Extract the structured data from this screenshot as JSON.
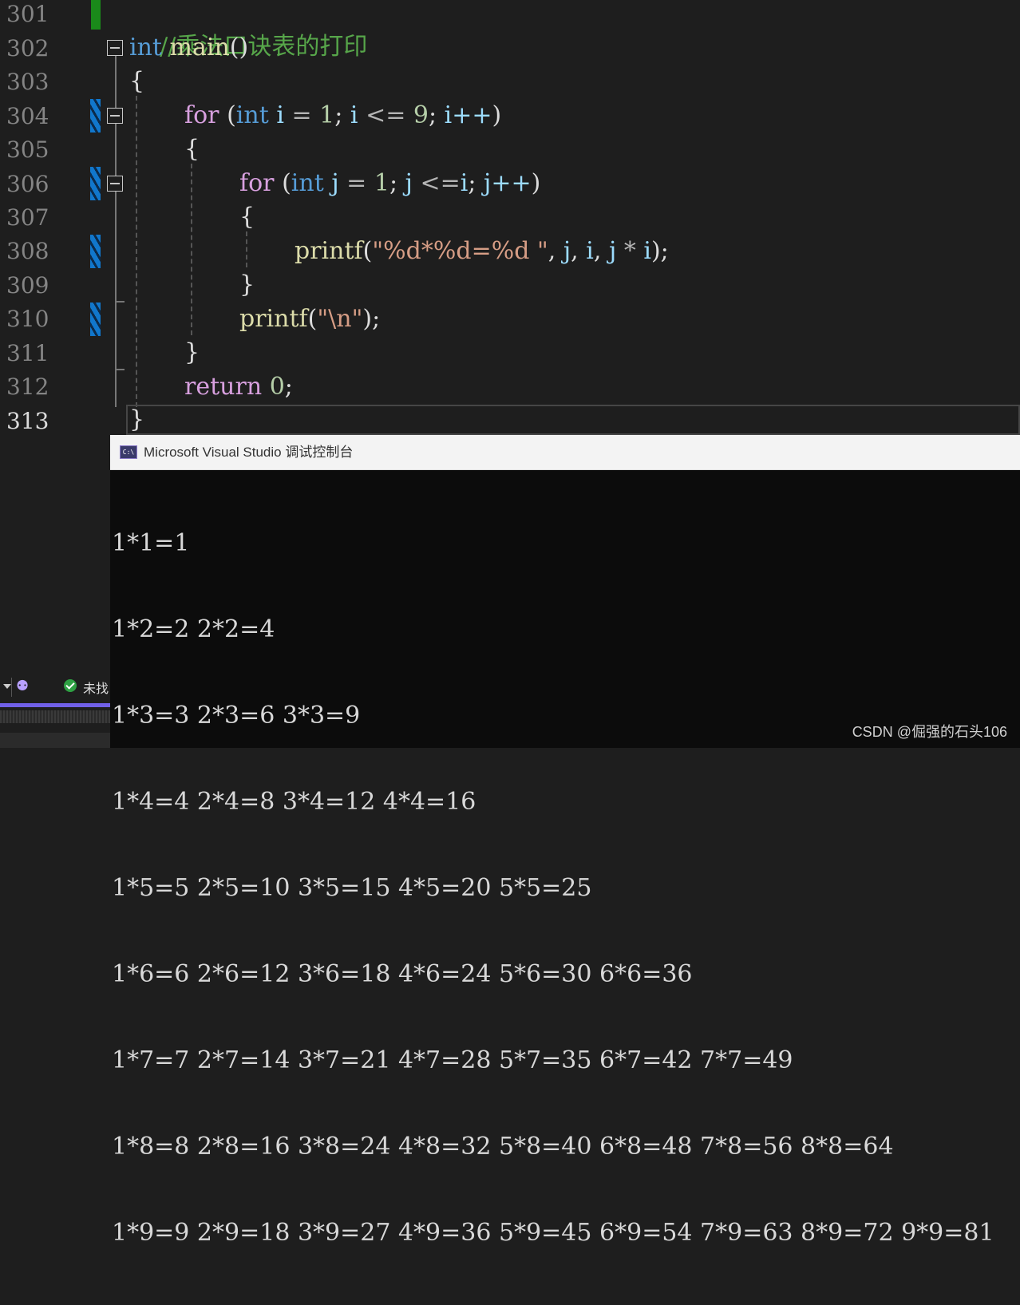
{
  "editor": {
    "line_numbers": [
      "301",
      "302",
      "303",
      "304",
      "305",
      "306",
      "307",
      "308",
      "309",
      "310",
      "311",
      "312",
      "313"
    ],
    "comment": "//乘法口诀表的打印",
    "tok": {
      "int": "int",
      "main": "main",
      "parens": "()",
      "lbrace": "{",
      "rbrace": "}",
      "for": "for",
      "lparen": "(",
      "rparen": ")",
      "i": "i",
      "j": "j",
      "eq": "=",
      "one": "1",
      "semi": ";",
      "lte": "<=",
      "nine": "9",
      "ipp": "i++",
      "jpp": "j++",
      "lte_eq": "<=",
      "printf": "printf",
      "fmt": "\"%d*%d=%d \"",
      "comma": ",",
      "star": "*",
      "newline_str": "\"\\n\"",
      "rparen_semi": ");",
      "return": "return",
      "zero": "0"
    }
  },
  "console": {
    "title": "Microsoft Visual Studio 调试控制台",
    "icon_label": "C:\\",
    "lines": [
      "1*1=1",
      "1*2=2 2*2=4",
      "1*3=3 2*3=6 3*3=9",
      "1*4=4 2*4=8 3*4=12 4*4=16",
      "1*5=5 2*5=10 3*5=15 4*5=20 5*5=25",
      "1*6=6 2*6=12 3*6=18 4*6=24 5*6=30 6*6=36",
      "1*7=7 2*7=14 3*7=21 4*7=28 5*7=35 6*7=42 7*7=49",
      "1*8=8 2*8=16 3*8=24 4*8=32 5*8=40 6*8=48 7*8=56 8*8=64",
      "1*9=9 2*9=18 3*9=27 4*9=36 5*9=45 6*9=54 7*9=63 8*9=72 9*9=81"
    ]
  },
  "status": {
    "text": "未找"
  },
  "watermark": "CSDN @倔强的石头106"
}
